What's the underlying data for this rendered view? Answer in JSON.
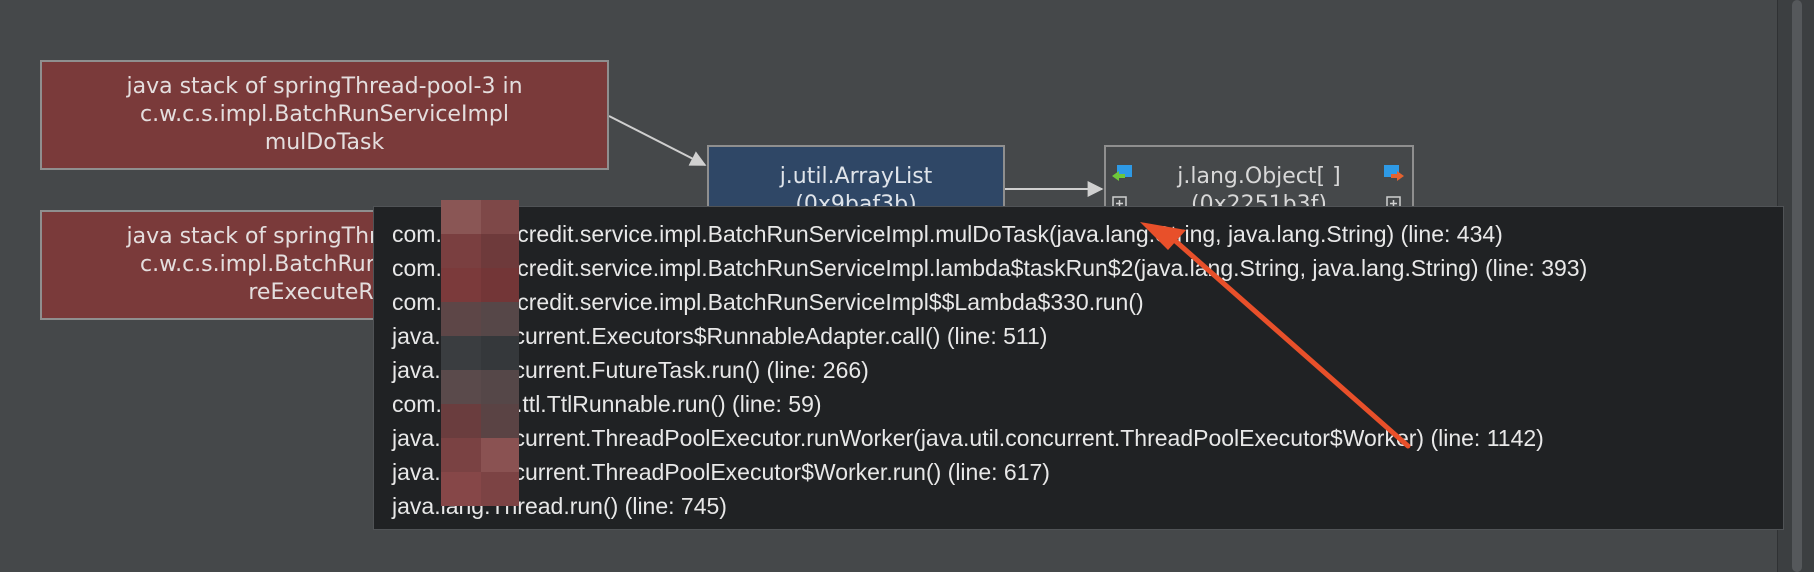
{
  "graph": {
    "nodes": {
      "stack1": {
        "lines": [
          "java stack of springThread-pool-3 in",
          "c.w.c.s.impl.BatchRunServiceImpl",
          "mulDoTask"
        ]
      },
      "stack2": {
        "lines": [
          "java stack of springThread-pool-3 in",
          "c.w.c.s.impl.BatchRunServiceImpl",
          "reExecuteRun"
        ]
      },
      "arraylist": {
        "lines": [
          "j.util.ArrayList",
          "(0x9baf3b)"
        ]
      },
      "objarray": {
        "lines": [
          "j.lang.Object[ ]",
          "(0x2251b3f)"
        ]
      }
    },
    "icons": {
      "incoming": "incoming-ref-icon",
      "outgoing": "outgoing-ref-icon",
      "expand": "expand-plus-icon"
    }
  },
  "tooltip": {
    "lines": [
      "com.xxxwin.credit.service.impl.BatchRunServiceImpl.mulDoTask(java.lang.String, java.lang.String) (line: 434)",
      "com.xxxwin.credit.service.impl.BatchRunServiceImpl.lambda$taskRun$2(java.lang.String, java.lang.String) (line: 393)",
      "com.xxxwin.credit.service.impl.BatchRunServiceImpl$$Lambda$330.run()",
      "java.util.concurrent.Executors$RunnableAdapter.call() (line: 511)",
      "java.util.concurrent.FutureTask.run() (line: 266)",
      "com.alibaba.ttl.TtlRunnable.run() (line: 59)",
      "java.util.concurrent.ThreadPoolExecutor.runWorker(java.util.concurrent.ThreadPoolExecutor$Worker) (line: 1142)",
      "java.util.concurrent.ThreadPoolExecutor$Worker.run() (line: 617)",
      "java.lang.Thread.run() (line: 745)"
    ]
  },
  "colors": {
    "stack_node": "#7a3a3a",
    "object_node": "#2f4766",
    "annotation_arrow": "#e8502a"
  }
}
